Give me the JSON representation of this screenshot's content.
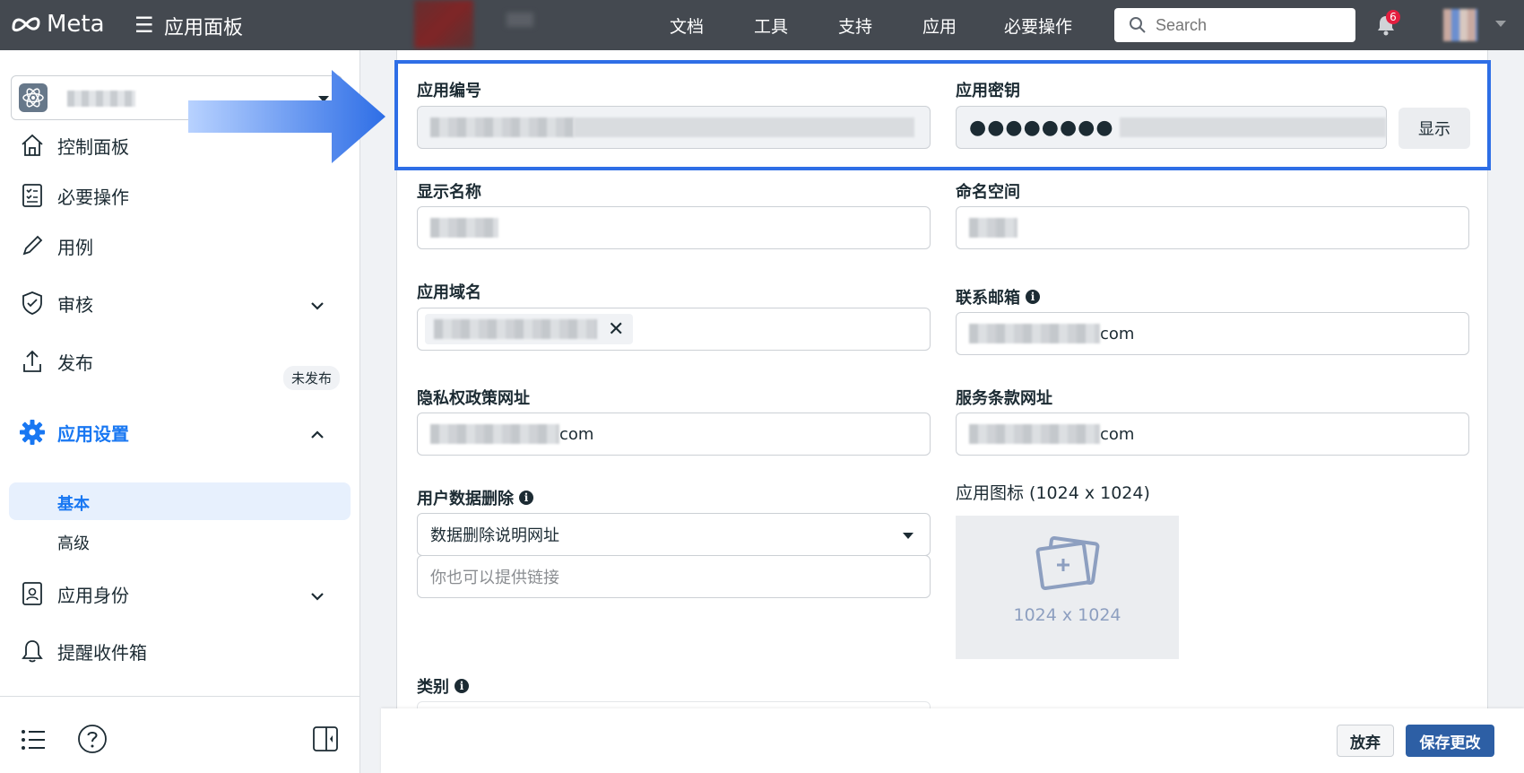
{
  "topbar": {
    "brand": "Meta",
    "app_title": "应用面板",
    "nav": [
      "文档",
      "工具",
      "支持",
      "应用",
      "必要操作"
    ],
    "search_placeholder": "Search",
    "notification_count": "6"
  },
  "sidebar": {
    "items": {
      "dashboard": "控制面板",
      "required_actions": "必要操作",
      "use_cases": "用例",
      "review": "审核",
      "publish": "发布",
      "publish_badge": "未发布",
      "app_settings": "应用设置",
      "basic": "基本",
      "advanced": "高级",
      "app_roles": "应用身份",
      "alerts_inbox": "提醒收件箱"
    }
  },
  "form": {
    "app_id_label": "应用编号",
    "app_secret_label": "应用密钥",
    "app_secret_value": "●●●●●●●●",
    "show_button": "显示",
    "display_name_label": "显示名称",
    "namespace_label": "命名空间",
    "app_domains_label": "应用域名",
    "contact_email_label": "联系邮箱",
    "contact_email_suffix": "com",
    "privacy_url_label": "隐私权政策网址",
    "privacy_url_suffix": "com",
    "tos_url_label": "服务条款网址",
    "tos_url_suffix": "com",
    "data_deletion_label": "用户数据删除",
    "data_deletion_selected": "数据删除说明网址",
    "data_deletion_placeholder": "你也可以提供链接",
    "app_icon_label": "应用图标 (1024 x 1024)",
    "app_icon_caption": "1024 x 1024",
    "category_label": "类别"
  },
  "footer": {
    "discard": "放弃",
    "save": "保存更改"
  },
  "colors": {
    "topbar": "#444950",
    "accent": "#1877f2",
    "highlight_border": "#2e6ee6",
    "save_button": "#2d5fa5"
  }
}
